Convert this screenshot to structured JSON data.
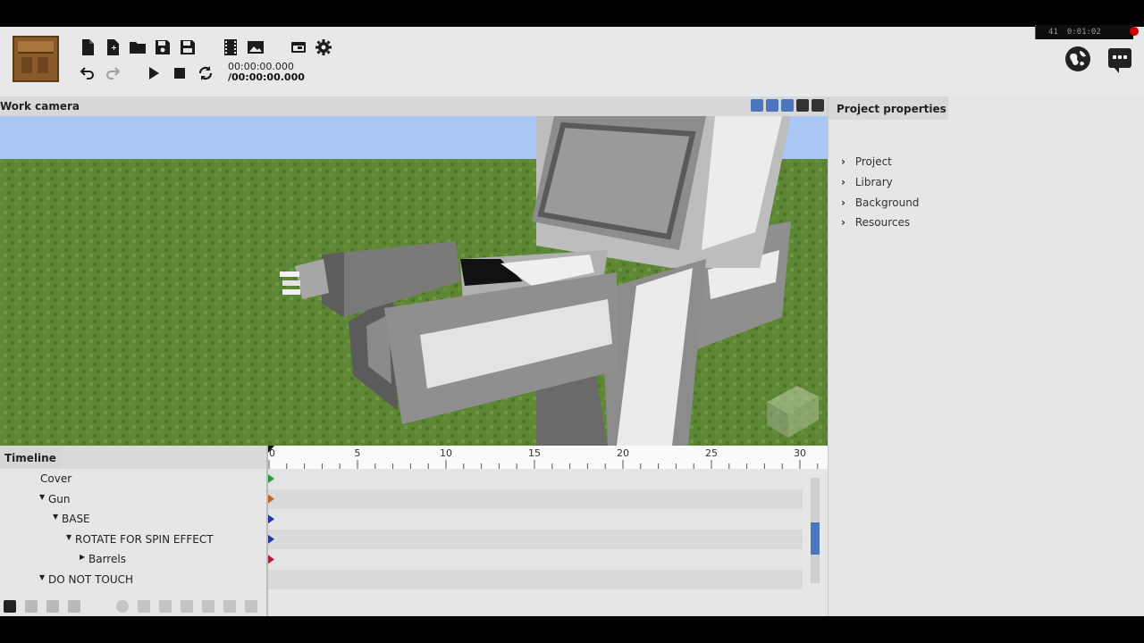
{
  "toolbar": {
    "time_current": "00:00:00.000",
    "time_total": "/00:00:00.000"
  },
  "overlay": {
    "fps": "41",
    "elapsed": "0:01:02"
  },
  "viewport": {
    "title": "Work camera"
  },
  "properties": {
    "tab_label": "Project properties",
    "items": [
      {
        "label": "Project"
      },
      {
        "label": "Library"
      },
      {
        "label": "Background"
      },
      {
        "label": "Resources"
      }
    ]
  },
  "timeline": {
    "tab_label": "Timeline",
    "ruler_labels": [
      "0",
      "5",
      "10",
      "15",
      "20",
      "25",
      "30"
    ],
    "tree": [
      {
        "label": "Cover",
        "depth": 0,
        "caret": "",
        "keyframe_color": "#2f9a3a"
      },
      {
        "label": "Gun",
        "depth": 0,
        "caret": "down",
        "keyframe_color": "#c4641e"
      },
      {
        "label": "BASE",
        "depth": 1,
        "caret": "down",
        "keyframe_color": "#2438a8"
      },
      {
        "label": "ROTATE FOR SPIN EFFECT",
        "depth": 2,
        "caret": "down",
        "keyframe_color": "#2438a8"
      },
      {
        "label": "Barrels",
        "depth": 3,
        "caret": "right",
        "keyframe_color": "#b0203a"
      },
      {
        "label": "DO NOT TOUCH",
        "depth": 0,
        "caret": "down",
        "keyframe_color": ""
      }
    ]
  },
  "colors": {
    "accent": "#4d74bf",
    "sky": "#a9c8f5",
    "grass": "#5f8a36",
    "model_dark": "#5b5b5b",
    "model_mid": "#8f8f8f",
    "model_light": "#e4e4e4"
  }
}
